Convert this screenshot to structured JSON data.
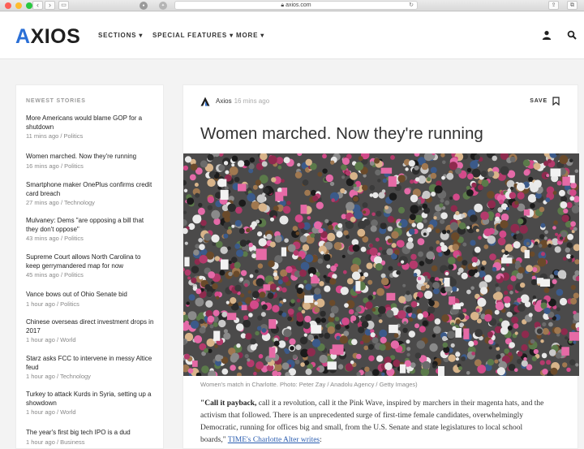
{
  "browser": {
    "url": "axios.com",
    "back_glyph": "‹",
    "forward_glyph": "›"
  },
  "header": {
    "logo_first": "A",
    "logo_rest": "XIOS",
    "nav": [
      {
        "label": "SECTIONS"
      },
      {
        "label": "SPECIAL FEATURES"
      },
      {
        "label": "MORE"
      }
    ]
  },
  "sidebar": {
    "title": "NEWEST STORIES",
    "stories": [
      {
        "title": "More Americans would blame GOP for a shutdown",
        "meta": "11 mins ago / Politics"
      },
      {
        "title": "Women marched. Now they're running",
        "meta": "16 mins ago / Politics"
      },
      {
        "title": "Smartphone maker OnePlus confirms credit card breach",
        "meta": "27 mins ago / Technology"
      },
      {
        "title": "Mulvaney: Dems \"are opposing a bill that they don't oppose\"",
        "meta": "43 mins ago / Politics"
      },
      {
        "title": "Supreme Court allows North Carolina to keep gerrymandered map for now",
        "meta": "45 mins ago / Politics"
      },
      {
        "title": "Vance bows out of Ohio Senate bid",
        "meta": "1 hour ago / Politics"
      },
      {
        "title": "Chinese overseas direct investment drops in 2017",
        "meta": "1 hour ago / World"
      },
      {
        "title": "Starz asks FCC to intervene in messy Altice feud",
        "meta": "1 hour ago / Technology"
      },
      {
        "title": "Turkey to attack Kurds in Syria, setting up a showdown",
        "meta": "1 hour ago / World"
      },
      {
        "title": "The year's first big tech IPO is a dud",
        "meta": "1 hour ago / Business"
      }
    ]
  },
  "article": {
    "author": "Axios",
    "time_ago": "16 mins ago",
    "save_label": "SAVE",
    "headline": "Women marched. Now they're running",
    "caption": "Women's match in Charlotte. Photo: Peter Zay / Anadolu Agency / Getty Images)",
    "body_lead": "\"Call it payback,",
    "body_text": " call it a revolution, call it the Pink Wave, inspired by marchers in their magenta hats, and the activism that followed. There is an unprecedented surge of first-time female candidates, overwhelmingly Democratic, running for offices big and small, from the U.S. Senate and state legislatures to local school boards,\"",
    "body_link": "TIME's Charlotte Alter writes",
    "body_end": ":"
  },
  "colors": {
    "brand_blue": "#2a6fd6",
    "link": "#2a5db0",
    "page_bg": "#f3f3f3"
  }
}
